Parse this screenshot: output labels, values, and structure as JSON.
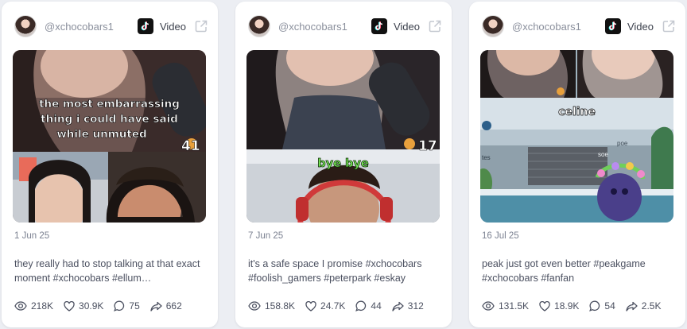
{
  "cards": [
    {
      "handle": "@xchocobars1",
      "platform": "Video",
      "overlay_lines": [
        "the most embarrassing",
        "thing i could have said",
        "while unmuted"
      ],
      "corner_count": "41",
      "date": "1 Jun 25",
      "caption": "they really had to stop talking at that exact moment #xchocobars #ellum…",
      "stats": {
        "views": "218K",
        "likes": "30.9K",
        "comments": "75",
        "shares": "662"
      }
    },
    {
      "handle": "@xchocobars1",
      "platform": "Video",
      "overlay_lines": [
        "bye bye"
      ],
      "corner_count": "17",
      "date": "7 Jun 25",
      "caption": "it's a safe space I promise #xchocobars #foolish_gamers #peterpark #eskay",
      "stats": {
        "views": "158.8K",
        "likes": "24.7K",
        "comments": "44",
        "shares": "312"
      }
    },
    {
      "handle": "@xchocobars1",
      "platform": "Video",
      "overlay_lines": [
        "celine"
      ],
      "corner_count": "",
      "game_labels": [
        "poe",
        "soe",
        "tes"
      ],
      "date": "16 Jul 25",
      "caption": "peak just got even better #peakgame #xchocobars #fanfan",
      "stats": {
        "views": "131.5K",
        "likes": "18.9K",
        "comments": "54",
        "shares": "2.5K"
      }
    }
  ],
  "icons": {
    "platform": "tiktok-icon",
    "open": "external-link-icon",
    "views": "eye-icon",
    "likes": "heart-icon",
    "comments": "comment-icon",
    "shares": "share-icon"
  },
  "colors": {
    "page_bg": "#eceef3",
    "card_bg": "#ffffff",
    "muted_text": "#8a8f9c",
    "body_text": "#4b5060",
    "overlay_green": "#7cf05a"
  }
}
